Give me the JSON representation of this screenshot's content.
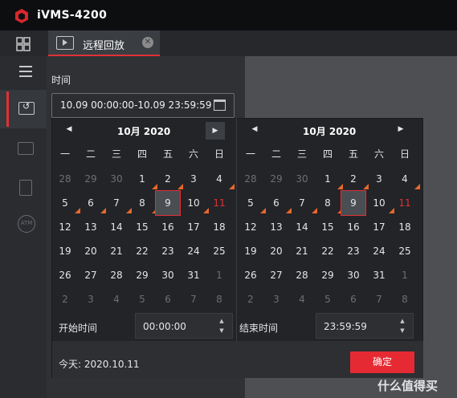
{
  "app": {
    "title": "iVMS-4200"
  },
  "tab": {
    "label": "远程回放",
    "close": "✕"
  },
  "panel": {
    "time_label": "时间",
    "range_value": "10.09 00:00:00-10.09 23:59:59"
  },
  "sidebar": {
    "atm_label": "ATM"
  },
  "weekdays": [
    "一",
    "二",
    "三",
    "四",
    "五",
    "六",
    "日"
  ],
  "calendars": [
    {
      "month_label": "10月  2020",
      "prev": "◀",
      "next": "▶",
      "time_label": "开始时间",
      "time_value": "00:00:00",
      "days": [
        {
          "d": "28",
          "dim": true
        },
        {
          "d": "29",
          "dim": true
        },
        {
          "d": "30",
          "dim": true
        },
        {
          "d": "1",
          "mark": true
        },
        {
          "d": "2",
          "mark": true
        },
        {
          "d": "3"
        },
        {
          "d": "4",
          "mark": true
        },
        {
          "d": "5",
          "mark": true
        },
        {
          "d": "6",
          "mark": true
        },
        {
          "d": "7",
          "mark": true
        },
        {
          "d": "8",
          "mark": true
        },
        {
          "d": "9",
          "sel": true
        },
        {
          "d": "10",
          "mark": true
        },
        {
          "d": "11",
          "red": true
        },
        {
          "d": "12"
        },
        {
          "d": "13"
        },
        {
          "d": "14"
        },
        {
          "d": "15"
        },
        {
          "d": "16"
        },
        {
          "d": "17"
        },
        {
          "d": "18"
        },
        {
          "d": "19"
        },
        {
          "d": "20"
        },
        {
          "d": "21"
        },
        {
          "d": "22"
        },
        {
          "d": "23"
        },
        {
          "d": "24"
        },
        {
          "d": "25"
        },
        {
          "d": "26"
        },
        {
          "d": "27"
        },
        {
          "d": "28"
        },
        {
          "d": "29"
        },
        {
          "d": "30"
        },
        {
          "d": "31"
        },
        {
          "d": "1",
          "dim": true
        },
        {
          "d": "2",
          "dim": true
        },
        {
          "d": "3",
          "dim": true
        },
        {
          "d": "4",
          "dim": true
        },
        {
          "d": "5",
          "dim": true
        },
        {
          "d": "6",
          "dim": true
        },
        {
          "d": "7",
          "dim": true
        },
        {
          "d": "8",
          "dim": true
        }
      ]
    },
    {
      "month_label": "10月  2020",
      "prev": "◀",
      "next": "▶",
      "time_label": "结束时间",
      "time_value": "23:59:59",
      "days": [
        {
          "d": "28",
          "dim": true
        },
        {
          "d": "29",
          "dim": true
        },
        {
          "d": "30",
          "dim": true
        },
        {
          "d": "1",
          "mark": true
        },
        {
          "d": "2",
          "mark": true
        },
        {
          "d": "3"
        },
        {
          "d": "4",
          "mark": true
        },
        {
          "d": "5",
          "mark": true
        },
        {
          "d": "6",
          "mark": true
        },
        {
          "d": "7",
          "mark": true
        },
        {
          "d": "8",
          "mark": true
        },
        {
          "d": "9",
          "sel": true
        },
        {
          "d": "10",
          "mark": true
        },
        {
          "d": "11",
          "red": true
        },
        {
          "d": "12"
        },
        {
          "d": "13"
        },
        {
          "d": "14"
        },
        {
          "d": "15"
        },
        {
          "d": "16"
        },
        {
          "d": "17"
        },
        {
          "d": "18"
        },
        {
          "d": "19"
        },
        {
          "d": "20"
        },
        {
          "d": "21"
        },
        {
          "d": "22"
        },
        {
          "d": "23"
        },
        {
          "d": "24"
        },
        {
          "d": "25"
        },
        {
          "d": "26"
        },
        {
          "d": "27"
        },
        {
          "d": "28"
        },
        {
          "d": "29"
        },
        {
          "d": "30"
        },
        {
          "d": "31"
        },
        {
          "d": "1",
          "dim": true
        },
        {
          "d": "2",
          "dim": true
        },
        {
          "d": "3",
          "dim": true
        },
        {
          "d": "4",
          "dim": true
        },
        {
          "d": "5",
          "dim": true
        },
        {
          "d": "6",
          "dim": true
        },
        {
          "d": "7",
          "dim": true
        },
        {
          "d": "8",
          "dim": true
        }
      ]
    }
  ],
  "footer": {
    "today": "今天: 2020.10.11",
    "ok_label": "确定"
  },
  "watermark": "什么值得买",
  "colors": {
    "accent": "#e03137",
    "record_marker": "#e9672a",
    "ok_button": "#e52a33"
  }
}
